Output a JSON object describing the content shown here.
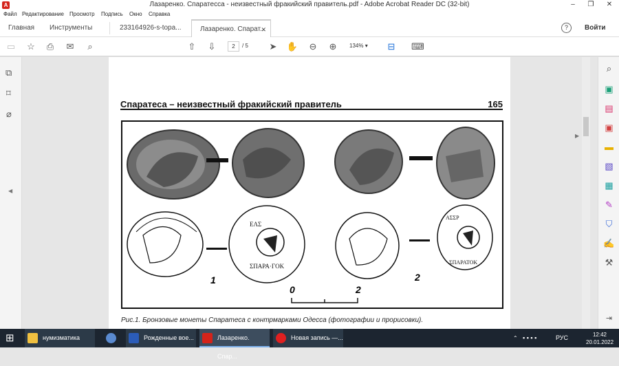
{
  "window": {
    "title": "Лазаренко. Спаратесса - неизвестный фракийский правитель.pdf - Adobe Acrobat Reader DC (32-bit)"
  },
  "menu": [
    "Файл",
    "Редактирование",
    "Просмотр",
    "Подпись",
    "Окно",
    "Справка"
  ],
  "tabs": {
    "home": "Главная",
    "tools": "Инструменты",
    "file1": "233164926-s-topa...",
    "file2": "Лазаренко. Спарат...",
    "signin": "Войти"
  },
  "toolbar": {
    "page_current": "2",
    "page_total": "/ 5",
    "zoom": "134%"
  },
  "doc": {
    "header_title": "Спаратеса – неизвестный фракийский правитель",
    "page_number": "165",
    "figure_labels": {
      "coin1": "1",
      "coin2": "2",
      "scale_zero": "0",
      "scale_two": "2"
    },
    "caption": "Рис.1. Бронзовые монеты Спаратеса с контрмарками Одесса (фотографии и прорисовки)."
  },
  "taskbar": {
    "items": [
      "нумизматика",
      "Рожденные вое...",
      "Лазаренко. Спар...",
      "Новая запись —..."
    ],
    "lang": "РУС",
    "time": "12:42",
    "date": "20.01.2022"
  },
  "colors": {
    "accent": "#d4231a",
    "taskbar": "#1c2530"
  }
}
